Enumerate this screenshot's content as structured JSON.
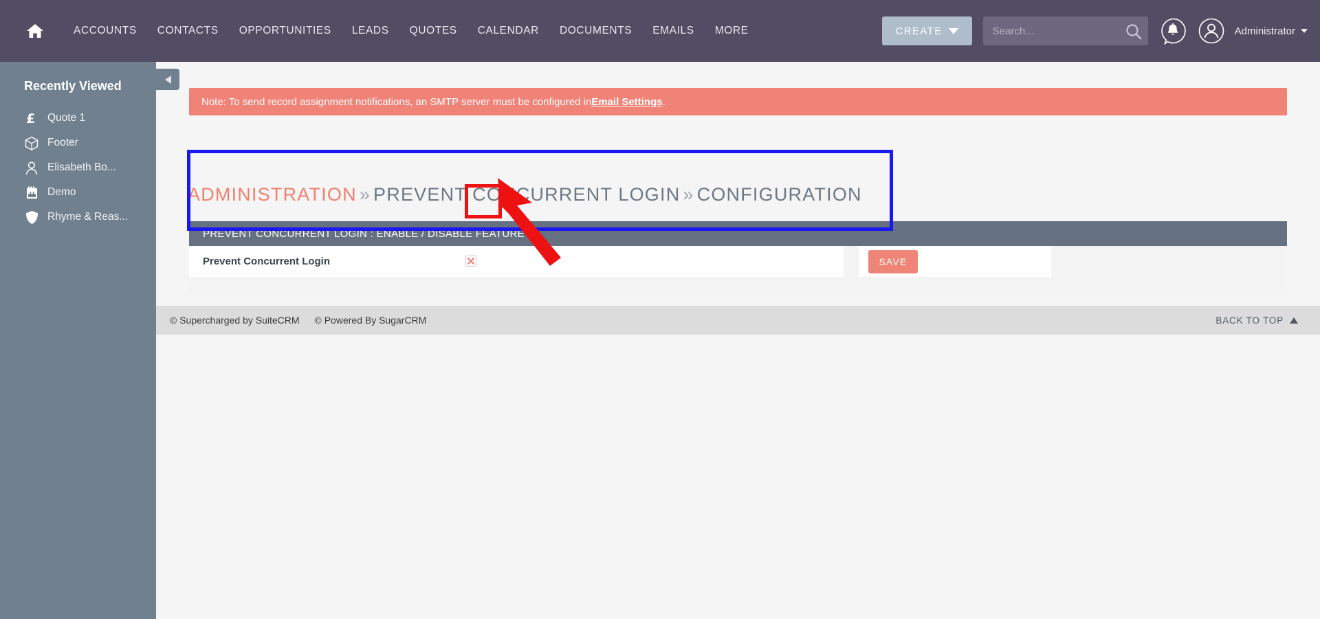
{
  "topnav": {
    "home_label": "Home",
    "items": [
      {
        "label": "ACCOUNTS"
      },
      {
        "label": "CONTACTS"
      },
      {
        "label": "OPPORTUNITIES"
      },
      {
        "label": "LEADS"
      },
      {
        "label": "QUOTES"
      },
      {
        "label": "CALENDAR"
      },
      {
        "label": "DOCUMENTS"
      },
      {
        "label": "EMAILS"
      },
      {
        "label": "MORE"
      }
    ],
    "create_label": "CREATE",
    "search_value": "",
    "search_placeholder": "Search...",
    "username": "Administrator"
  },
  "sidebar": {
    "title": "Recently Viewed",
    "items": [
      {
        "label": "Quote 1",
        "icon": "pound-icon"
      },
      {
        "label": "Footer",
        "icon": "cube-icon"
      },
      {
        "label": "Elisabeth Bo...",
        "icon": "person-icon"
      },
      {
        "label": "Demo",
        "icon": "building-icon"
      },
      {
        "label": "Rhyme & Reas...",
        "icon": "shield-icon"
      }
    ],
    "collapse_icon": "chevron-left-icon"
  },
  "alert": {
    "text_before": "Note: To send record assignment notifications, an SMTP server must be configured in ",
    "link_label": "Email Settings",
    "text_after": "."
  },
  "breadcrumb": {
    "root": "ADMINISTRATION",
    "sep": "»",
    "level2": "PREVENT CONCURRENT LOGIN",
    "level3": "CONFIGURATION"
  },
  "panel": {
    "header": "PREVENT CONCURRENT LOGIN : ENABLE / DISABLE FEATURE",
    "row_label": "Prevent Concurrent Login",
    "checkbox_state": "unchecked-x",
    "save_label": "SAVE"
  },
  "footer": {
    "copy1": "© Supercharged by SuiteCRM",
    "copy2": "© Powered By SugarCRM",
    "back_to_top": "BACK TO TOP"
  },
  "colors": {
    "nav_bg": "#534d64",
    "sidebar_bg": "#70808f",
    "accent_salmon": "#ee8577",
    "panel_header": "#657080",
    "create_btn": "#aebdc9",
    "annotation_blue": "#1a18f0",
    "annotation_red": "#ee1111"
  }
}
